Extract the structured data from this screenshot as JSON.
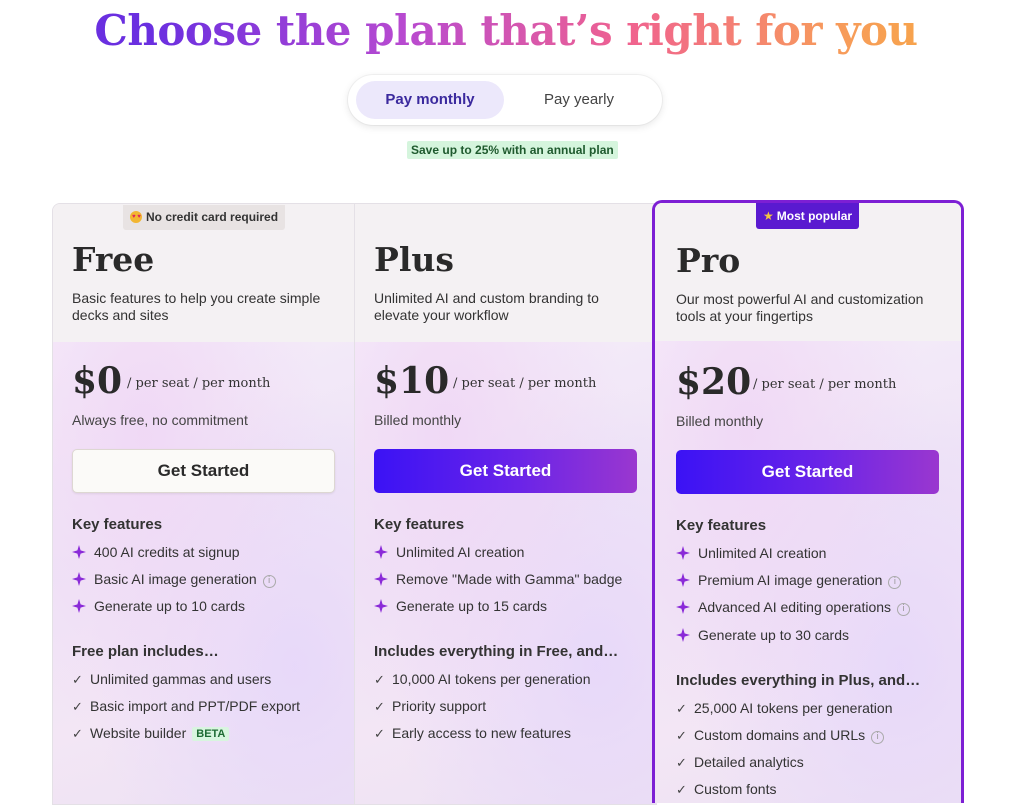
{
  "header": {
    "title": "Choose the plan that’s right for you"
  },
  "billing_toggle": {
    "monthly_label": "Pay monthly",
    "yearly_label": "Pay yearly",
    "selected": "monthly"
  },
  "save_note": "Save up to 25% with an annual plan",
  "badges": {
    "no_credit_card": "No credit card required",
    "most_popular": "Most popular"
  },
  "plans": [
    {
      "name": "Free",
      "description": "Basic features to help you create simple decks and sites",
      "price": "$0",
      "per": "/ per seat / per month",
      "billing": "Always free, no commitment",
      "cta": "Get Started",
      "key_features_title": "Key features",
      "key_features": [
        "400 AI credits at signup",
        "Basic AI image generation",
        "Generate up to 10 cards"
      ],
      "includes_title": "Free plan includes…",
      "includes": [
        "Unlimited gammas and users",
        "Basic import and PPT/PDF export",
        "Website builder"
      ],
      "beta_label": "BETA"
    },
    {
      "name": "Plus",
      "description": "Unlimited AI and custom branding to elevate your workflow",
      "price": "$10",
      "per": "/ per seat / per month",
      "billing": "Billed monthly",
      "cta": "Get Started",
      "key_features_title": "Key features",
      "key_features": [
        "Unlimited AI creation",
        "Remove \"Made with Gamma\" badge",
        "Generate up to 15 cards"
      ],
      "includes_title": "Includes everything in Free, and…",
      "includes": [
        "10,000 AI tokens per generation",
        "Priority support",
        "Early access to new features"
      ]
    },
    {
      "name": "Pro",
      "description": "Our most powerful AI and customization tools at your fingertips",
      "price": "$20",
      "per": "/ per seat / per month",
      "billing": "Billed monthly",
      "cta": "Get Started",
      "key_features_title": "Key features",
      "key_features": [
        "Unlimited AI creation",
        "Premium AI image generation",
        "Advanced AI editing operations",
        "Generate up to 30 cards"
      ],
      "includes_title": "Includes everything in Plus, and…",
      "includes": [
        "25,000 AI tokens per generation",
        "Custom domains and URLs",
        "Detailed analytics",
        "Custom fonts"
      ]
    }
  ],
  "colors": {
    "accent": "#5a1ad0",
    "button_gradient_start": "#3b12f5",
    "button_gradient_end": "#9a37cf",
    "spark": "#8a2ad8"
  },
  "icons": {
    "spark": "sparkle-icon",
    "check": "checkmark-icon",
    "info": "info-icon",
    "emoji": "heart-eyes-icon",
    "star": "star-icon"
  }
}
